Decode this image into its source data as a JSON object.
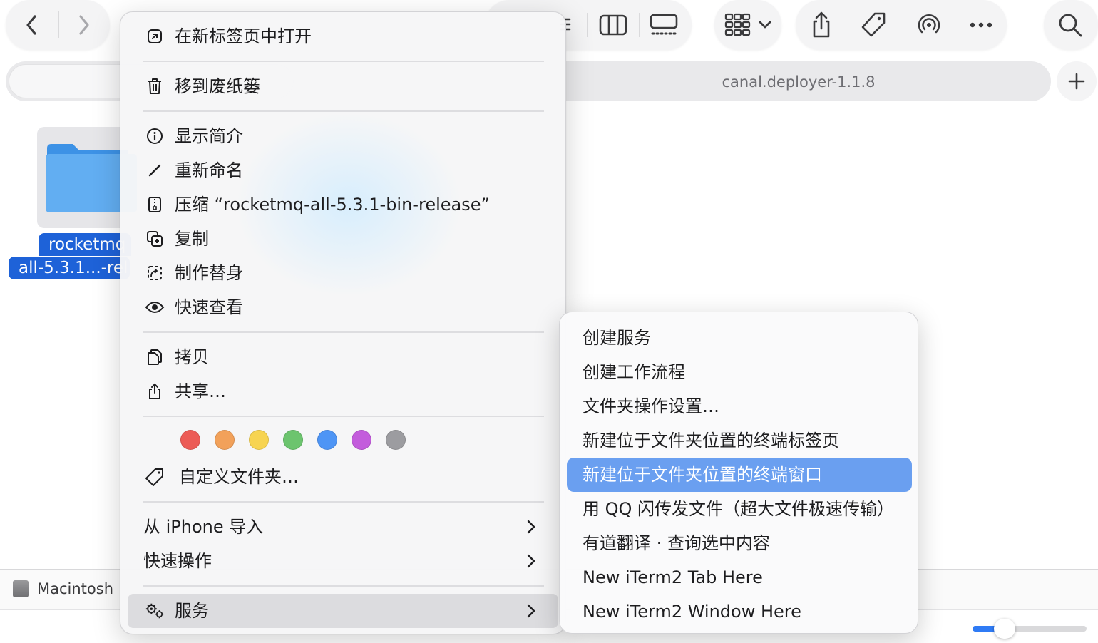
{
  "toolbar": {
    "back_icon": "chevron-left-icon",
    "forward_icon": "chevron-right-icon",
    "view_icons": [
      "list-view-icon",
      "column-view-icon",
      "gallery-view-icon"
    ],
    "group_icon": "group-icon",
    "share_icon": "share-icon",
    "tag_icon": "tag-icon",
    "airdrop_icon": "airdrop-icon",
    "more_icon": "more-icon",
    "search_icon": "search-icon"
  },
  "tabbar": {
    "active_tab_title": "canal.deployer-1.1.8",
    "add_tab_icon": "plus-icon"
  },
  "file": {
    "label_line1": "rocketmq",
    "label_line2": "all-5.3.1...-rel",
    "icon": "folder-icon"
  },
  "pathbar": {
    "disk_label": "Macintosh"
  },
  "context_menu": {
    "open_in_new_tab": "在新标签页中打开",
    "move_to_trash": "移到废纸篓",
    "get_info": "显示简介",
    "rename": "重新命名",
    "compress": "压缩 “rocketmq-all-5.3.1-bin-release”",
    "duplicate": "复制",
    "make_alias": "制作替身",
    "quick_look": "快速查看",
    "copy": "拷贝",
    "share": "共享…",
    "tag_colors": [
      "#ec5b56",
      "#f2a15a",
      "#f7d451",
      "#6cc46e",
      "#4e95f5",
      "#c35cdc",
      "#9c9ca0"
    ],
    "custom_folder": "自定义文件夹…",
    "import_from_iphone": "从 iPhone 导入",
    "quick_actions": "快速操作",
    "services": "服务"
  },
  "services_menu": {
    "items": [
      "创建服务",
      "创建工作流程",
      "文件夹操作设置…",
      "新建位于文件夹位置的终端标签页",
      "新建位于文件夹位置的终端窗口",
      "用 QQ 闪传发文件（超大文件极速传输）",
      "有道翻译 · 查询选中内容",
      "New iTerm2 Tab Here",
      "New iTerm2 Window Here"
    ],
    "highlighted_index": 4
  },
  "colors": {
    "selection_blue": "#1e62d8",
    "submenu_highlight": "#6a9ff0",
    "slider_accent": "#2f7bf5"
  },
  "zoom_slider": {
    "value": 0.28
  }
}
